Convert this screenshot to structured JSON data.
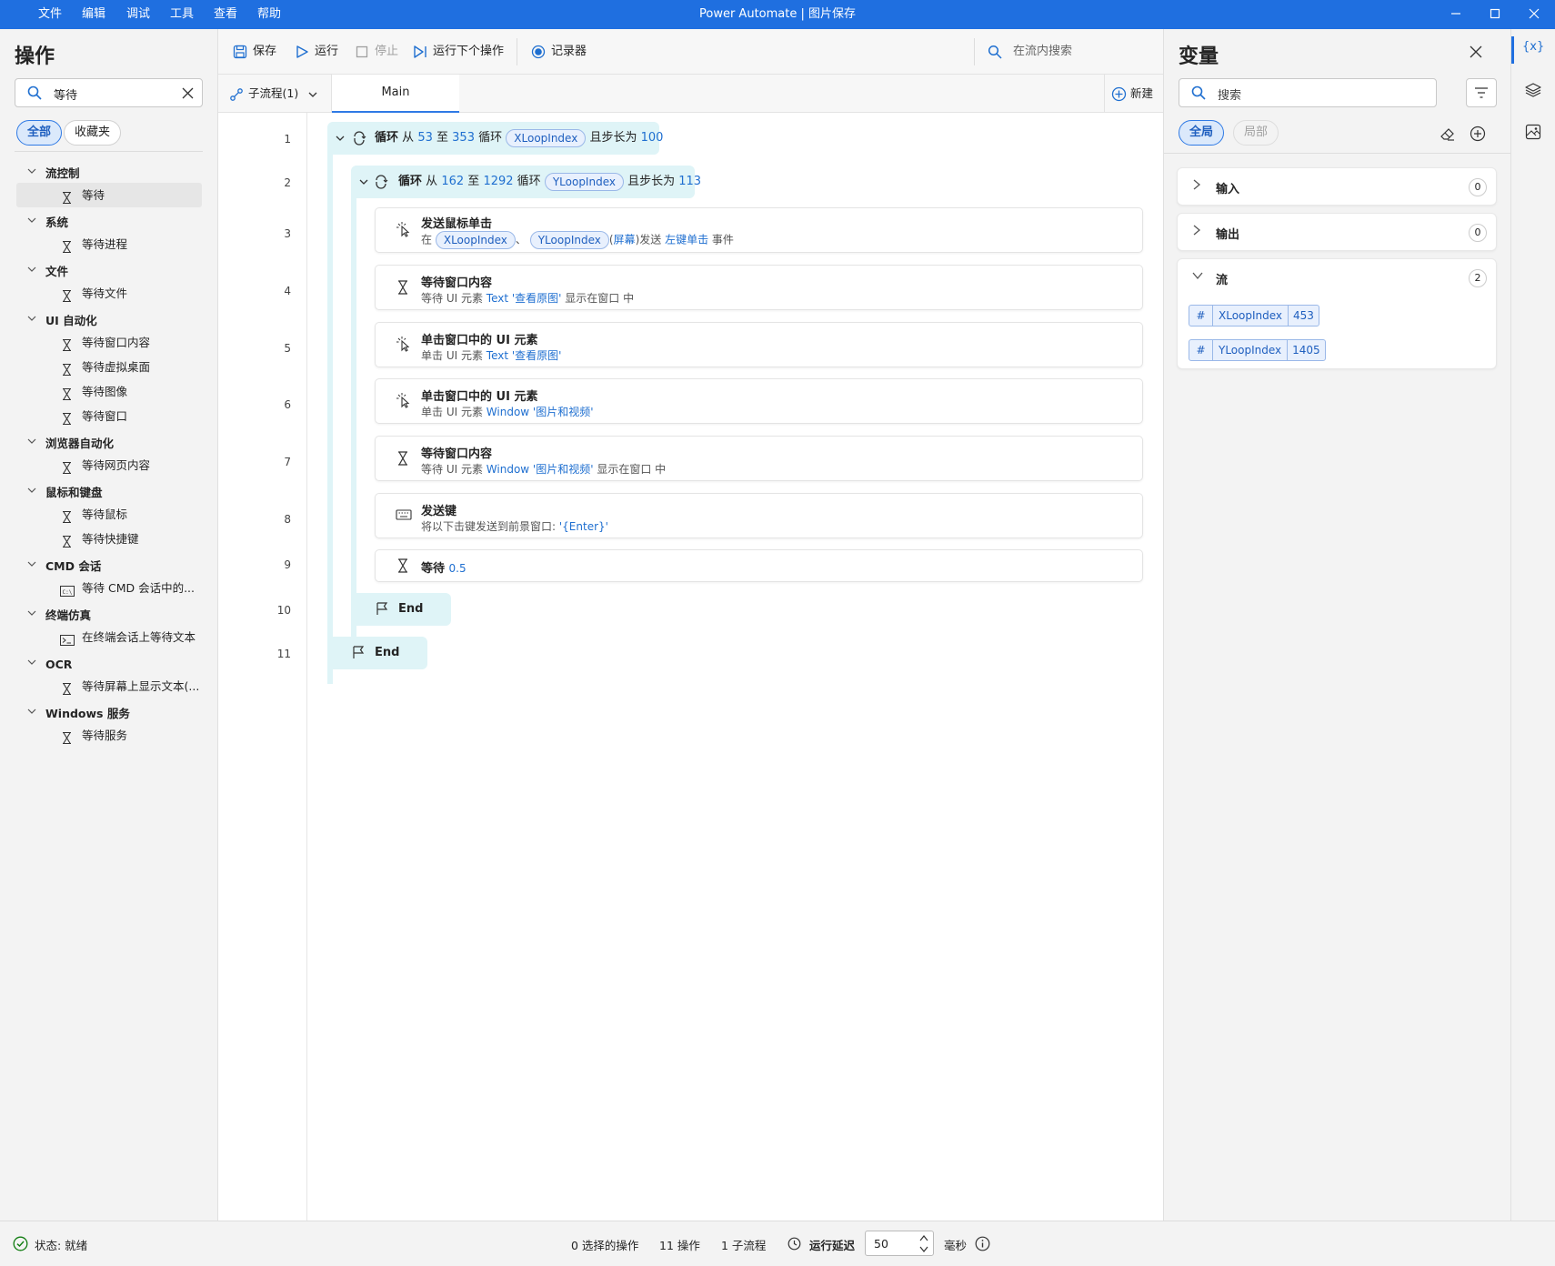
{
  "window": {
    "title": "Power Automate | 图片保存",
    "menu": [
      "文件",
      "编辑",
      "调试",
      "工具",
      "查看",
      "帮助"
    ]
  },
  "actions_panel": {
    "title": "操作",
    "search_value": "等待",
    "filters": [
      "全部",
      "收藏夹"
    ],
    "tree": [
      {
        "category": "流控制",
        "items": [
          "等待"
        ]
      },
      {
        "category": "系统",
        "items": [
          "等待进程"
        ]
      },
      {
        "category": "文件",
        "items": [
          "等待文件"
        ]
      },
      {
        "category": "UI 自动化",
        "items": [
          "等待窗口内容",
          "等待虚拟桌面",
          "等待图像",
          "等待窗口"
        ]
      },
      {
        "category": "浏览器自动化",
        "items": [
          "等待网页内容"
        ]
      },
      {
        "category": "鼠标和键盘",
        "items": [
          "等待鼠标",
          "等待快捷键"
        ]
      },
      {
        "category": "CMD 会话",
        "items": [
          "等待 CMD 会话中的..."
        ]
      },
      {
        "category": "终端仿真",
        "items": [
          "在终端会话上等待文本"
        ]
      },
      {
        "category": "OCR",
        "items": [
          "等待屏幕上显示文本(..."
        ]
      },
      {
        "category": "Windows 服务",
        "items": [
          "等待服务"
        ]
      }
    ]
  },
  "toolbar": {
    "save": "保存",
    "run": "运行",
    "stop": "停止",
    "run_next": "运行下个操作",
    "recorder": "记录器",
    "flow_search_placeholder": "在流内搜索"
  },
  "tabs": {
    "subflows": "子流程(1)",
    "main": "Main",
    "new": "新建"
  },
  "flow": {
    "line_numbers": [
      "1",
      "2",
      "3",
      "4",
      "5",
      "6",
      "7",
      "8",
      "9",
      "10",
      "11"
    ],
    "loop1": {
      "kw": "循环",
      "from": "从",
      "start": "53",
      "to": "至",
      "end": "353",
      "loop_word": "循环",
      "var": "XLoopIndex",
      "step_word": "且步长为",
      "step": "100"
    },
    "loop2": {
      "kw": "循环",
      "from": "从",
      "start": "162",
      "to": "至",
      "end": "1292",
      "loop_word": "循环",
      "var": "YLoopIndex",
      "step_word": "且步长为",
      "step": "113"
    },
    "a3": {
      "title": "发送鼠标单击",
      "p1": "在",
      "x": "XLoopIndex",
      "sep": "、",
      "y": "YLoopIndex",
      "lp": "(",
      "screen": "屏幕",
      "rp": ")发送",
      "click": "左键单击",
      "p2": "事件"
    },
    "a4": {
      "title": "等待窗口内容",
      "p1": "等待 UI 元素",
      "elem": "Text '查看原图'",
      "p2": "显示在窗口  中"
    },
    "a5": {
      "title": "单击窗口中的 UI 元素",
      "p1": "单击 UI 元素",
      "elem": "Text '查看原图'"
    },
    "a6": {
      "title": "单击窗口中的 UI 元素",
      "p1": "单击 UI 元素",
      "elem": "Window '图片和视频'"
    },
    "a7": {
      "title": "等待窗口内容",
      "p1": "等待 UI 元素",
      "elem": "Window '图片和视频'",
      "p2": "显示在窗口  中"
    },
    "a8": {
      "title": "发送键",
      "p1": "将以下击键发送到前景窗口:",
      "keys": "'{Enter}'"
    },
    "a9": {
      "title": "等待",
      "value": "0.5"
    },
    "end_inner": "End",
    "end_outer": "End"
  },
  "variables_panel": {
    "title": "变量",
    "search_placeholder": "搜索",
    "filters": [
      "全局",
      "局部"
    ],
    "sections": {
      "input": {
        "label": "输入",
        "count": "0"
      },
      "output": {
        "label": "输出",
        "count": "0"
      },
      "flow": {
        "label": "流",
        "count": "2"
      }
    },
    "vars": [
      {
        "name": "XLoopIndex",
        "value": "453"
      },
      {
        "name": "YLoopIndex",
        "value": "1405"
      }
    ]
  },
  "rail": {
    "vars_icon_text": "{x}"
  },
  "status": {
    "state": "状态: 就绪",
    "selected": "0 选择的操作",
    "actions": "11 操作",
    "subflows": "1 子流程",
    "delay_label": "运行延迟",
    "delay_value": "50",
    "unit": "毫秒"
  },
  "colors": {
    "accent": "#1f6fe0",
    "loop_bg": "#dff4f7",
    "link": "#1f6fd0"
  }
}
